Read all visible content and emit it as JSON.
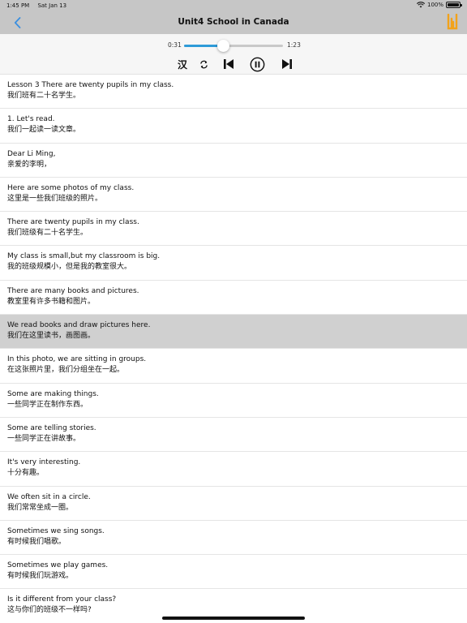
{
  "status_bar": {
    "time": "1:45 PM",
    "date": "Sat Jan 13",
    "battery": "100%"
  },
  "nav": {
    "title": "Unit4 School in Canada",
    "back_icon": "chevron-left-icon",
    "right_icon": "bookmark-icon"
  },
  "player": {
    "current_time": "0:31",
    "total_time": "1:23",
    "progress": 0.39,
    "han_label": "汉",
    "accent_color": "#2e9bd8"
  },
  "lines": [
    {
      "en": "Lesson 3 There are twenty pupils in my class.",
      "zh": "我们班有二十名学生。"
    },
    {
      "en": "1. Let's read.",
      "zh": "我们一起读一读文章。"
    },
    {
      "en": "Dear Li Ming,",
      "zh": "亲爱的李明，"
    },
    {
      "en": "Here are some photos of my class.",
      "zh": "这里是一些我们班级的照片。"
    },
    {
      "en": "There are twenty pupils in my class.",
      "zh": "我们班级有二十名学生。"
    },
    {
      "en": "My class is small,but my classroom is big.",
      "zh": "我的班级规模小，但是我的教室很大。"
    },
    {
      "en": "There are many books and pictures.",
      "zh": "教室里有许多书籍和图片。"
    },
    {
      "en": "We read books and draw pictures here.",
      "zh": "我们在这里读书，画图画。"
    },
    {
      "en": "In this photo, we are sitting in groups.",
      "zh": "在这张照片里，我们分组坐在一起。"
    },
    {
      "en": "Some are making things.",
      "zh": "一些同学正在制作东西。"
    },
    {
      "en": "Some are telling stories.",
      "zh": "一些同学正在讲故事。"
    },
    {
      "en": "It's very interesting.",
      "zh": "十分有趣。"
    },
    {
      "en": "We often sit in a circle.",
      "zh": "我们常常坐成一圈。"
    },
    {
      "en": "Sometimes we sing songs.",
      "zh": "有时候我们唱歌。"
    },
    {
      "en": "Sometimes we play games.",
      "zh": "有时候我们玩游戏。"
    },
    {
      "en": "Is it different from your class?",
      "zh": "这与你们的班级不一样吗?"
    }
  ],
  "active_line": 7
}
